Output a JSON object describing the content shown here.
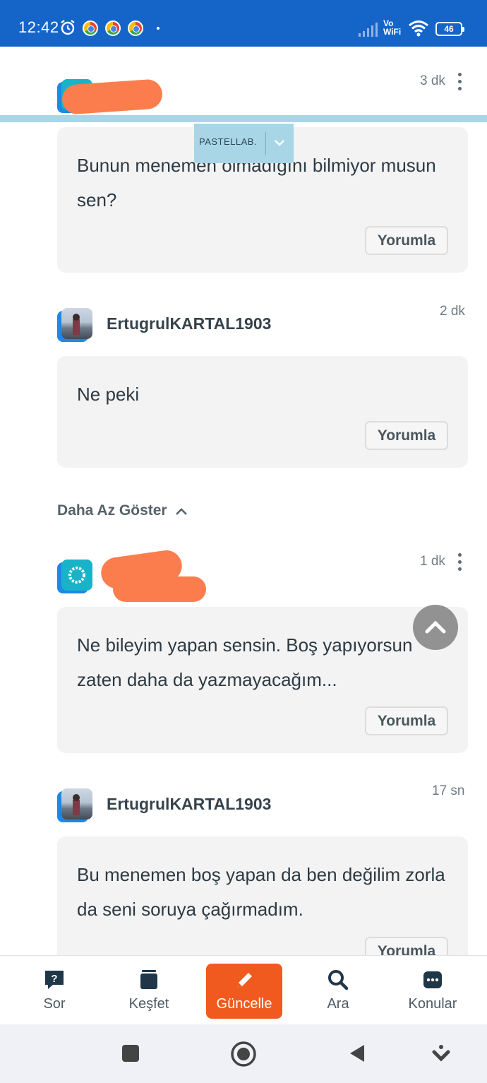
{
  "status_bar": {
    "time": "12:42",
    "network_label_line1": "Vo",
    "network_label_line2": "WiFi",
    "battery": "46"
  },
  "ad": {
    "brand": "PASTELLAB."
  },
  "comments": [
    {
      "username": "",
      "time": "3 dk",
      "text": "Bunun menemen olmadığını bilmiyor musun sen?",
      "reply_label": "Yorumla",
      "avatar": "logo-avatar",
      "has_menu": true,
      "username_redacted": true
    },
    {
      "username": "ErtugrulKARTAL1903",
      "time": "2 dk",
      "text": "Ne peki",
      "reply_label": "Yorumla",
      "avatar": "photo-avatar",
      "has_menu": false,
      "username_redacted": false
    },
    {
      "username": "",
      "time": "1 dk",
      "text": "Ne bileyim yapan sensin. Boş yapıyorsun zaten daha da yazmayacağım...",
      "reply_label": "Yorumla",
      "avatar": "logo-avatar",
      "has_menu": true,
      "username_redacted": true
    },
    {
      "username": "ErtugrulKARTAL1903",
      "time": "17 sn",
      "text": "Bu menemen boş yapan da ben değilim zorla da seni soruya çağırmadım.",
      "reply_label": "Yorumla",
      "avatar": "photo-avatar",
      "has_menu": false,
      "username_redacted": false
    }
  ],
  "show_less_label": "Daha Az Göster",
  "bottom_nav": {
    "items": [
      {
        "label": "Sor",
        "icon": "question-icon",
        "active": false
      },
      {
        "label": "Keşfet",
        "icon": "stack-icon",
        "active": false
      },
      {
        "label": "Güncelle",
        "icon": "pencil-icon",
        "active": true
      },
      {
        "label": "Ara",
        "icon": "search-icon",
        "active": false
      },
      {
        "label": "Konular",
        "icon": "chat-bubble-icon",
        "active": false
      }
    ]
  },
  "colors": {
    "status_bar": "#1565c9",
    "accent": "#f05a1e",
    "bubble": "#f3f3f3",
    "redaction": "#fb7d4d",
    "ad_bar": "#a9d6e6"
  }
}
